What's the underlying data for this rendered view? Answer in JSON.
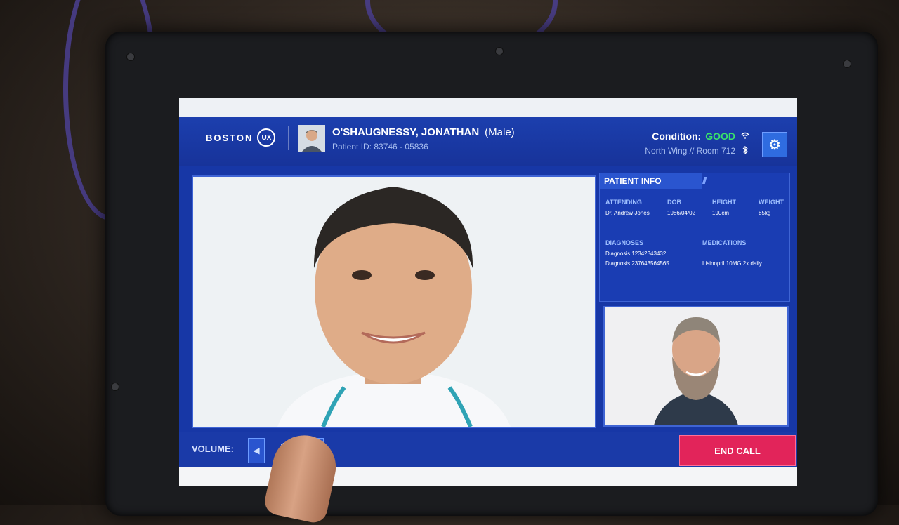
{
  "logo": {
    "text": "BOSTON",
    "mark": "UX"
  },
  "patient": {
    "name": "O'SHAUGNESSY, JONATHAN",
    "sex": "(Male)",
    "id_label": "Patient ID: 83746 - 05836"
  },
  "status": {
    "condition_label": "Condition:",
    "condition_value": "GOOD",
    "location": "North Wing // Room 712",
    "condition_color": "#39e36b"
  },
  "info": {
    "title": "PATIENT INFO",
    "attending_label": "ATTENDING",
    "attending_value": "Dr. Andrew Jones",
    "dob_label": "DOB",
    "dob_value": "1986/04/02",
    "height_label": "HEIGHT",
    "height_value": "190cm",
    "weight_label": "WEIGHT",
    "weight_value": "85kg",
    "diagnoses_label": "DIAGNOSES",
    "diagnoses": [
      "Diagnosis 12342343432",
      "Diagnosis 237643564565"
    ],
    "medications_label": "MEDICATIONS",
    "medications": [
      "Lisinopril 10MG 2x daily"
    ]
  },
  "controls": {
    "volume_label": "VOLUME:",
    "volume_value": "1",
    "end_call_label": "END CALL",
    "end_call_color": "#e2245a"
  },
  "icons": [
    "gear-icon",
    "wifi-icon",
    "bluetooth-icon",
    "volume-down-icon",
    "volume-up-icon"
  ],
  "theme": {
    "primary": "#1737a6",
    "accent": "#2f6ce0"
  }
}
